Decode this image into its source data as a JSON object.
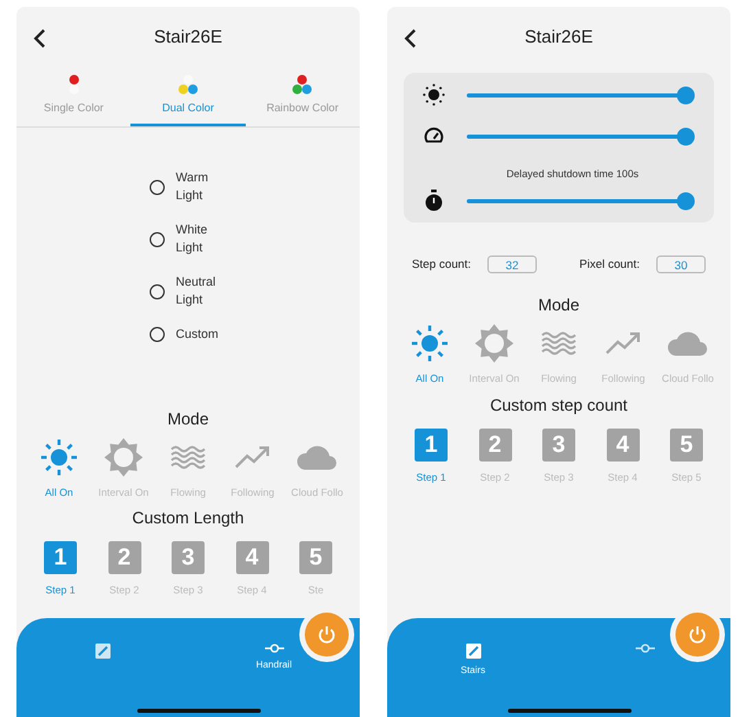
{
  "screens": [
    {
      "title": "Stair26E",
      "color_tabs": [
        {
          "label": "Single Color",
          "kind": "single",
          "selected": false
        },
        {
          "label": "Dual Color",
          "kind": "dual",
          "selected": true
        },
        {
          "label": "Rainbow Color",
          "kind": "rainbow",
          "selected": false
        }
      ],
      "light_options": [
        {
          "label": "Warm Light",
          "selected": false
        },
        {
          "label": "White Light",
          "selected": false
        },
        {
          "label": "Neutral Light",
          "selected": false
        },
        {
          "label": "Custom",
          "selected": false
        }
      ],
      "mode": {
        "title": "Mode",
        "items": [
          {
            "label": "All On",
            "kind": "sun",
            "selected": true
          },
          {
            "label": "Interval On",
            "kind": "interval",
            "selected": false
          },
          {
            "label": "Flowing",
            "kind": "waves",
            "selected": false
          },
          {
            "label": "Following",
            "kind": "trend",
            "selected": false
          },
          {
            "label": "Cloud Follo",
            "kind": "cloud",
            "selected": false
          }
        ]
      },
      "steps": {
        "title": "Custom Length",
        "items": [
          {
            "number": "1",
            "label": "Step 1",
            "selected": true
          },
          {
            "number": "2",
            "label": "Step 2",
            "selected": false
          },
          {
            "number": "3",
            "label": "Step 3",
            "selected": false
          },
          {
            "number": "4",
            "label": "Step 4",
            "selected": false
          },
          {
            "number": "5",
            "label": "Ste",
            "selected": false
          }
        ]
      },
      "bottom_nav": [
        {
          "kind": "stairs",
          "selected": false
        },
        {
          "kind": "handrail",
          "label": "Handrail",
          "selected": true
        }
      ]
    },
    {
      "title": "Stair26E",
      "sliders": [
        {
          "kind": "brightness",
          "level": 1
        },
        {
          "kind": "speed",
          "level": 1
        },
        {
          "kind": "timer",
          "caption": "Delayed shutdown time 100s",
          "level": 1
        }
      ],
      "counts": [
        {
          "label": "Step count:",
          "value": "32"
        },
        {
          "label": "Pixel count:",
          "value": "30"
        }
      ],
      "mode": {
        "title": "Mode",
        "items": [
          {
            "label": "All On",
            "kind": "sun",
            "selected": true
          },
          {
            "label": "Interval On",
            "kind": "interval",
            "selected": false
          },
          {
            "label": "Flowing",
            "kind": "waves",
            "selected": false
          },
          {
            "label": "Following",
            "kind": "trend",
            "selected": false
          },
          {
            "label": "Cloud Follo",
            "kind": "cloud",
            "selected": false
          }
        ]
      },
      "steps": {
        "title": "Custom step count",
        "items": [
          {
            "number": "1",
            "label": "Step 1",
            "selected": true
          },
          {
            "number": "2",
            "label": "Step 2",
            "selected": false
          },
          {
            "number": "3",
            "label": "Step 3",
            "selected": false
          },
          {
            "number": "4",
            "label": "Step 4",
            "selected": false
          },
          {
            "number": "5",
            "label": "Step 5",
            "selected": false
          }
        ]
      },
      "bottom_nav": [
        {
          "kind": "stairs",
          "label": "Stairs",
          "selected": true
        },
        {
          "kind": "handrail",
          "selected": false
        }
      ]
    }
  ]
}
